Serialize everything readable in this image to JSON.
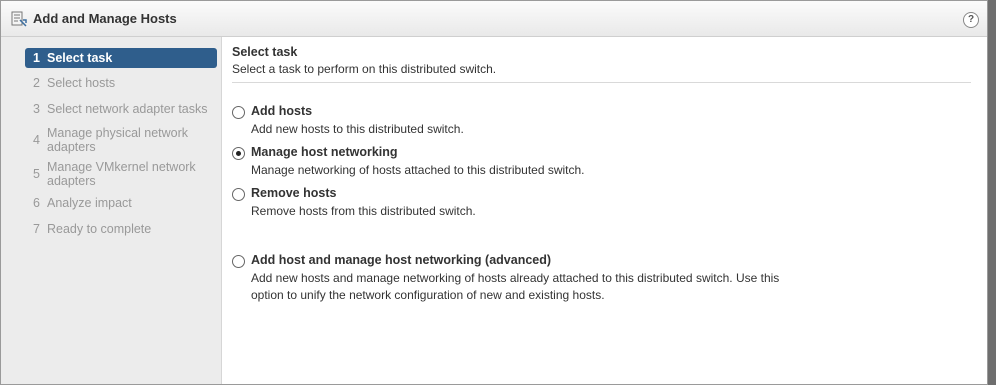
{
  "window": {
    "title": "Add and Manage Hosts",
    "help_glyph": "?"
  },
  "sidebar": {
    "steps": [
      {
        "num": "1",
        "label": "Select task",
        "active": true
      },
      {
        "num": "2",
        "label": "Select hosts"
      },
      {
        "num": "3",
        "label": "Select network adapter tasks"
      },
      {
        "num": "4",
        "label": "Manage physical network adapters"
      },
      {
        "num": "5",
        "label": "Manage VMkernel network adapters"
      },
      {
        "num": "6",
        "label": "Analyze impact"
      },
      {
        "num": "7",
        "label": "Ready to complete"
      }
    ]
  },
  "main": {
    "title": "Select task",
    "subtitle": "Select a task to perform on this distributed switch.",
    "options": [
      {
        "label": "Add hosts",
        "description": "Add new hosts to this distributed switch.",
        "checked": false
      },
      {
        "label": "Manage host networking",
        "description": "Manage networking of hosts attached to this distributed switch.",
        "checked": true
      },
      {
        "label": "Remove hosts",
        "description": "Remove hosts from this distributed switch.",
        "checked": false
      },
      {
        "label": "Add host and manage host networking (advanced)",
        "description": "Add new hosts and manage networking of hosts already attached to this distributed switch. Use this option to unify the network configuration of new and existing hosts.",
        "checked": false
      }
    ]
  },
  "colors": {
    "active_step_bg": "#2f5e8c",
    "sidebar_bg": "#ececec",
    "inactive_step_text": "#999999"
  }
}
